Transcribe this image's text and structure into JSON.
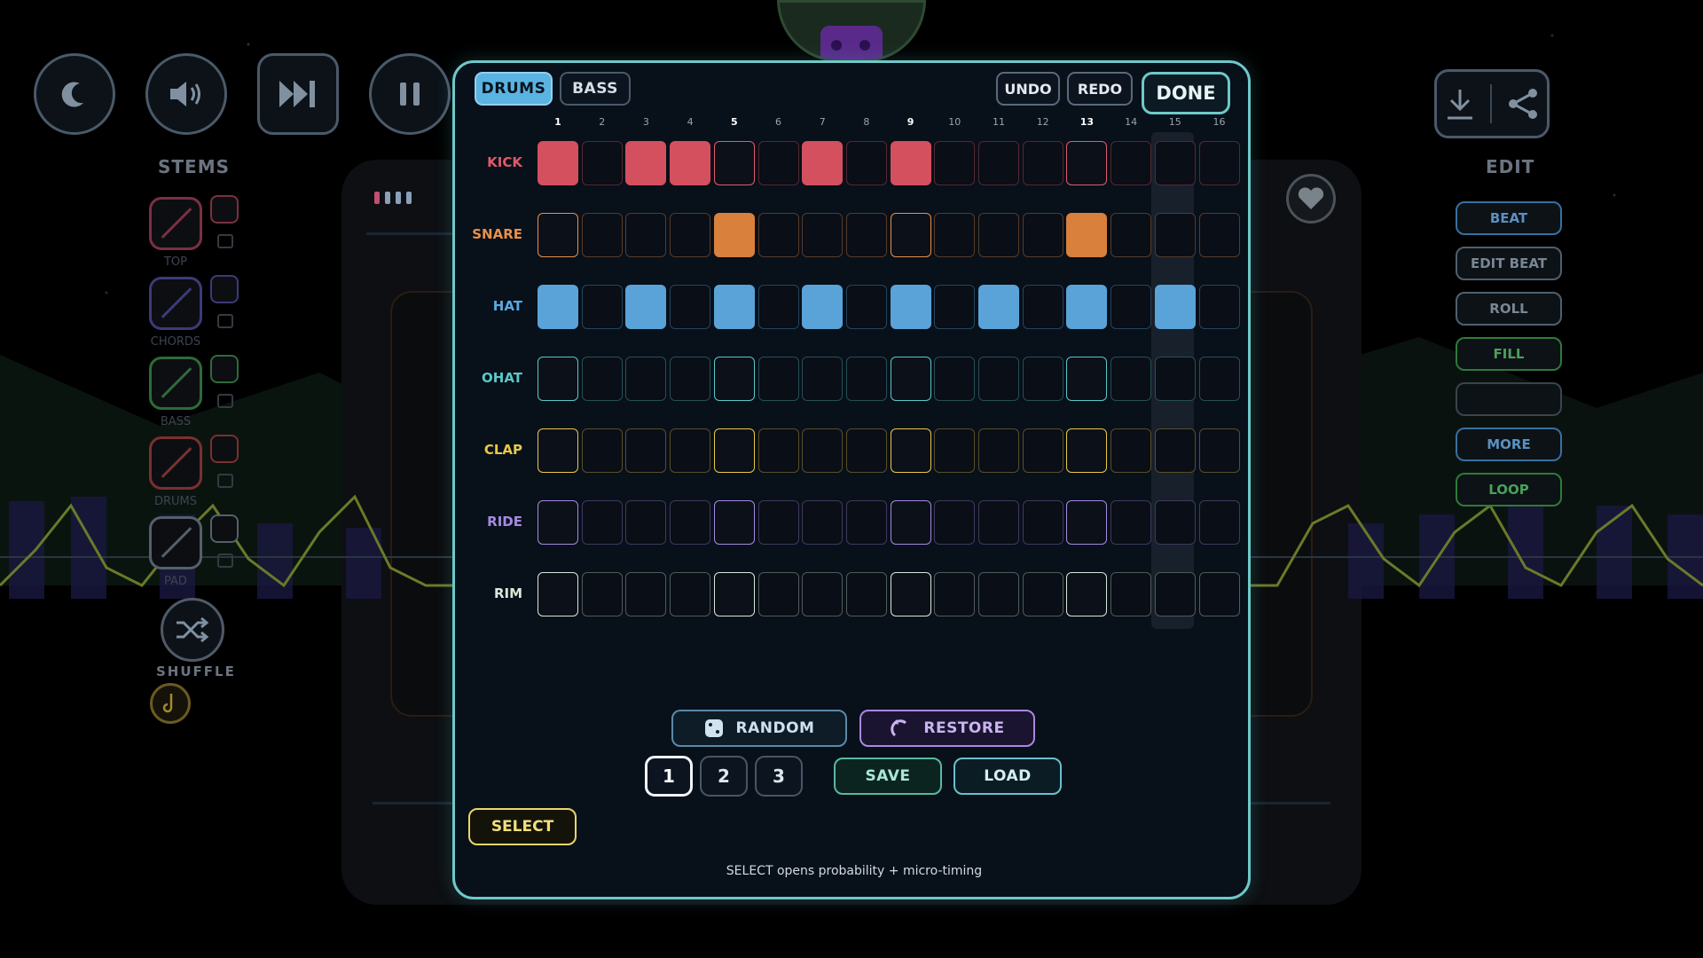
{
  "sidebar_left": {
    "stems_title": "STEMS",
    "stems": [
      {
        "label": "TOP",
        "color": "#7a3140"
      },
      {
        "label": "CHORDS",
        "color": "#3d3a7a"
      },
      {
        "label": "BASS",
        "color": "#2f6a3a"
      },
      {
        "label": "DRUMS",
        "color": "#7a3030"
      },
      {
        "label": "PAD",
        "color": "#55606a"
      }
    ],
    "shuffle_label": "SHUFFLE"
  },
  "sidebar_right": {
    "edit_title": "EDIT",
    "buttons": [
      {
        "label": "BEAT",
        "color": "#3a6fa0"
      },
      {
        "label": "EDIT BEAT",
        "color": "#50606e"
      },
      {
        "label": "ROLL",
        "color": "#50606e"
      },
      {
        "label": "FILL",
        "color": "#2f7a3a"
      },
      {
        "label": "",
        "color": "#3a444e"
      },
      {
        "label": "MORE",
        "color": "#3a6fa0"
      },
      {
        "label": "LOOP",
        "color": "#2f7a3a"
      }
    ]
  },
  "modal": {
    "tabs": {
      "drums": "DRUMS",
      "bass": "BASS"
    },
    "undo_label": "UNDO",
    "redo_label": "REDO",
    "done_label": "DONE",
    "steps": [
      "1",
      "2",
      "3",
      "4",
      "5",
      "6",
      "7",
      "8",
      "9",
      "10",
      "11",
      "12",
      "13",
      "14",
      "15",
      "16"
    ],
    "current_step": 15,
    "rows": [
      {
        "label": "KICK",
        "color": "#e05a6a",
        "fill": "#d4505f",
        "active": [
          1,
          3,
          4,
          7,
          9
        ]
      },
      {
        "label": "SNARE",
        "color": "#e8904a",
        "fill": "#d9803c",
        "active": [
          5,
          13
        ]
      },
      {
        "label": "HAT",
        "color": "#5aa8e0",
        "fill": "#5aa3d8",
        "active": [
          1,
          3,
          5,
          7,
          9,
          11,
          13,
          15
        ]
      },
      {
        "label": "OHAT",
        "color": "#5ac8c8",
        "fill": "#5ac8c8",
        "active": []
      },
      {
        "label": "CLAP",
        "color": "#e8c84a",
        "fill": "#e8c84a",
        "active": []
      },
      {
        "label": "RIDE",
        "color": "#a58ae0",
        "fill": "#a58ae0",
        "active": []
      },
      {
        "label": "RIM",
        "color": "#d8e8d8",
        "fill": "#d8e8d8",
        "active": []
      }
    ],
    "random_label": "RANDOM",
    "restore_label": "RESTORE",
    "slots": [
      "1",
      "2",
      "3"
    ],
    "active_slot": "1",
    "save_label": "SAVE",
    "load_label": "LOAD",
    "select_label": "SELECT",
    "hint": "SELECT opens probability + micro-timing"
  }
}
